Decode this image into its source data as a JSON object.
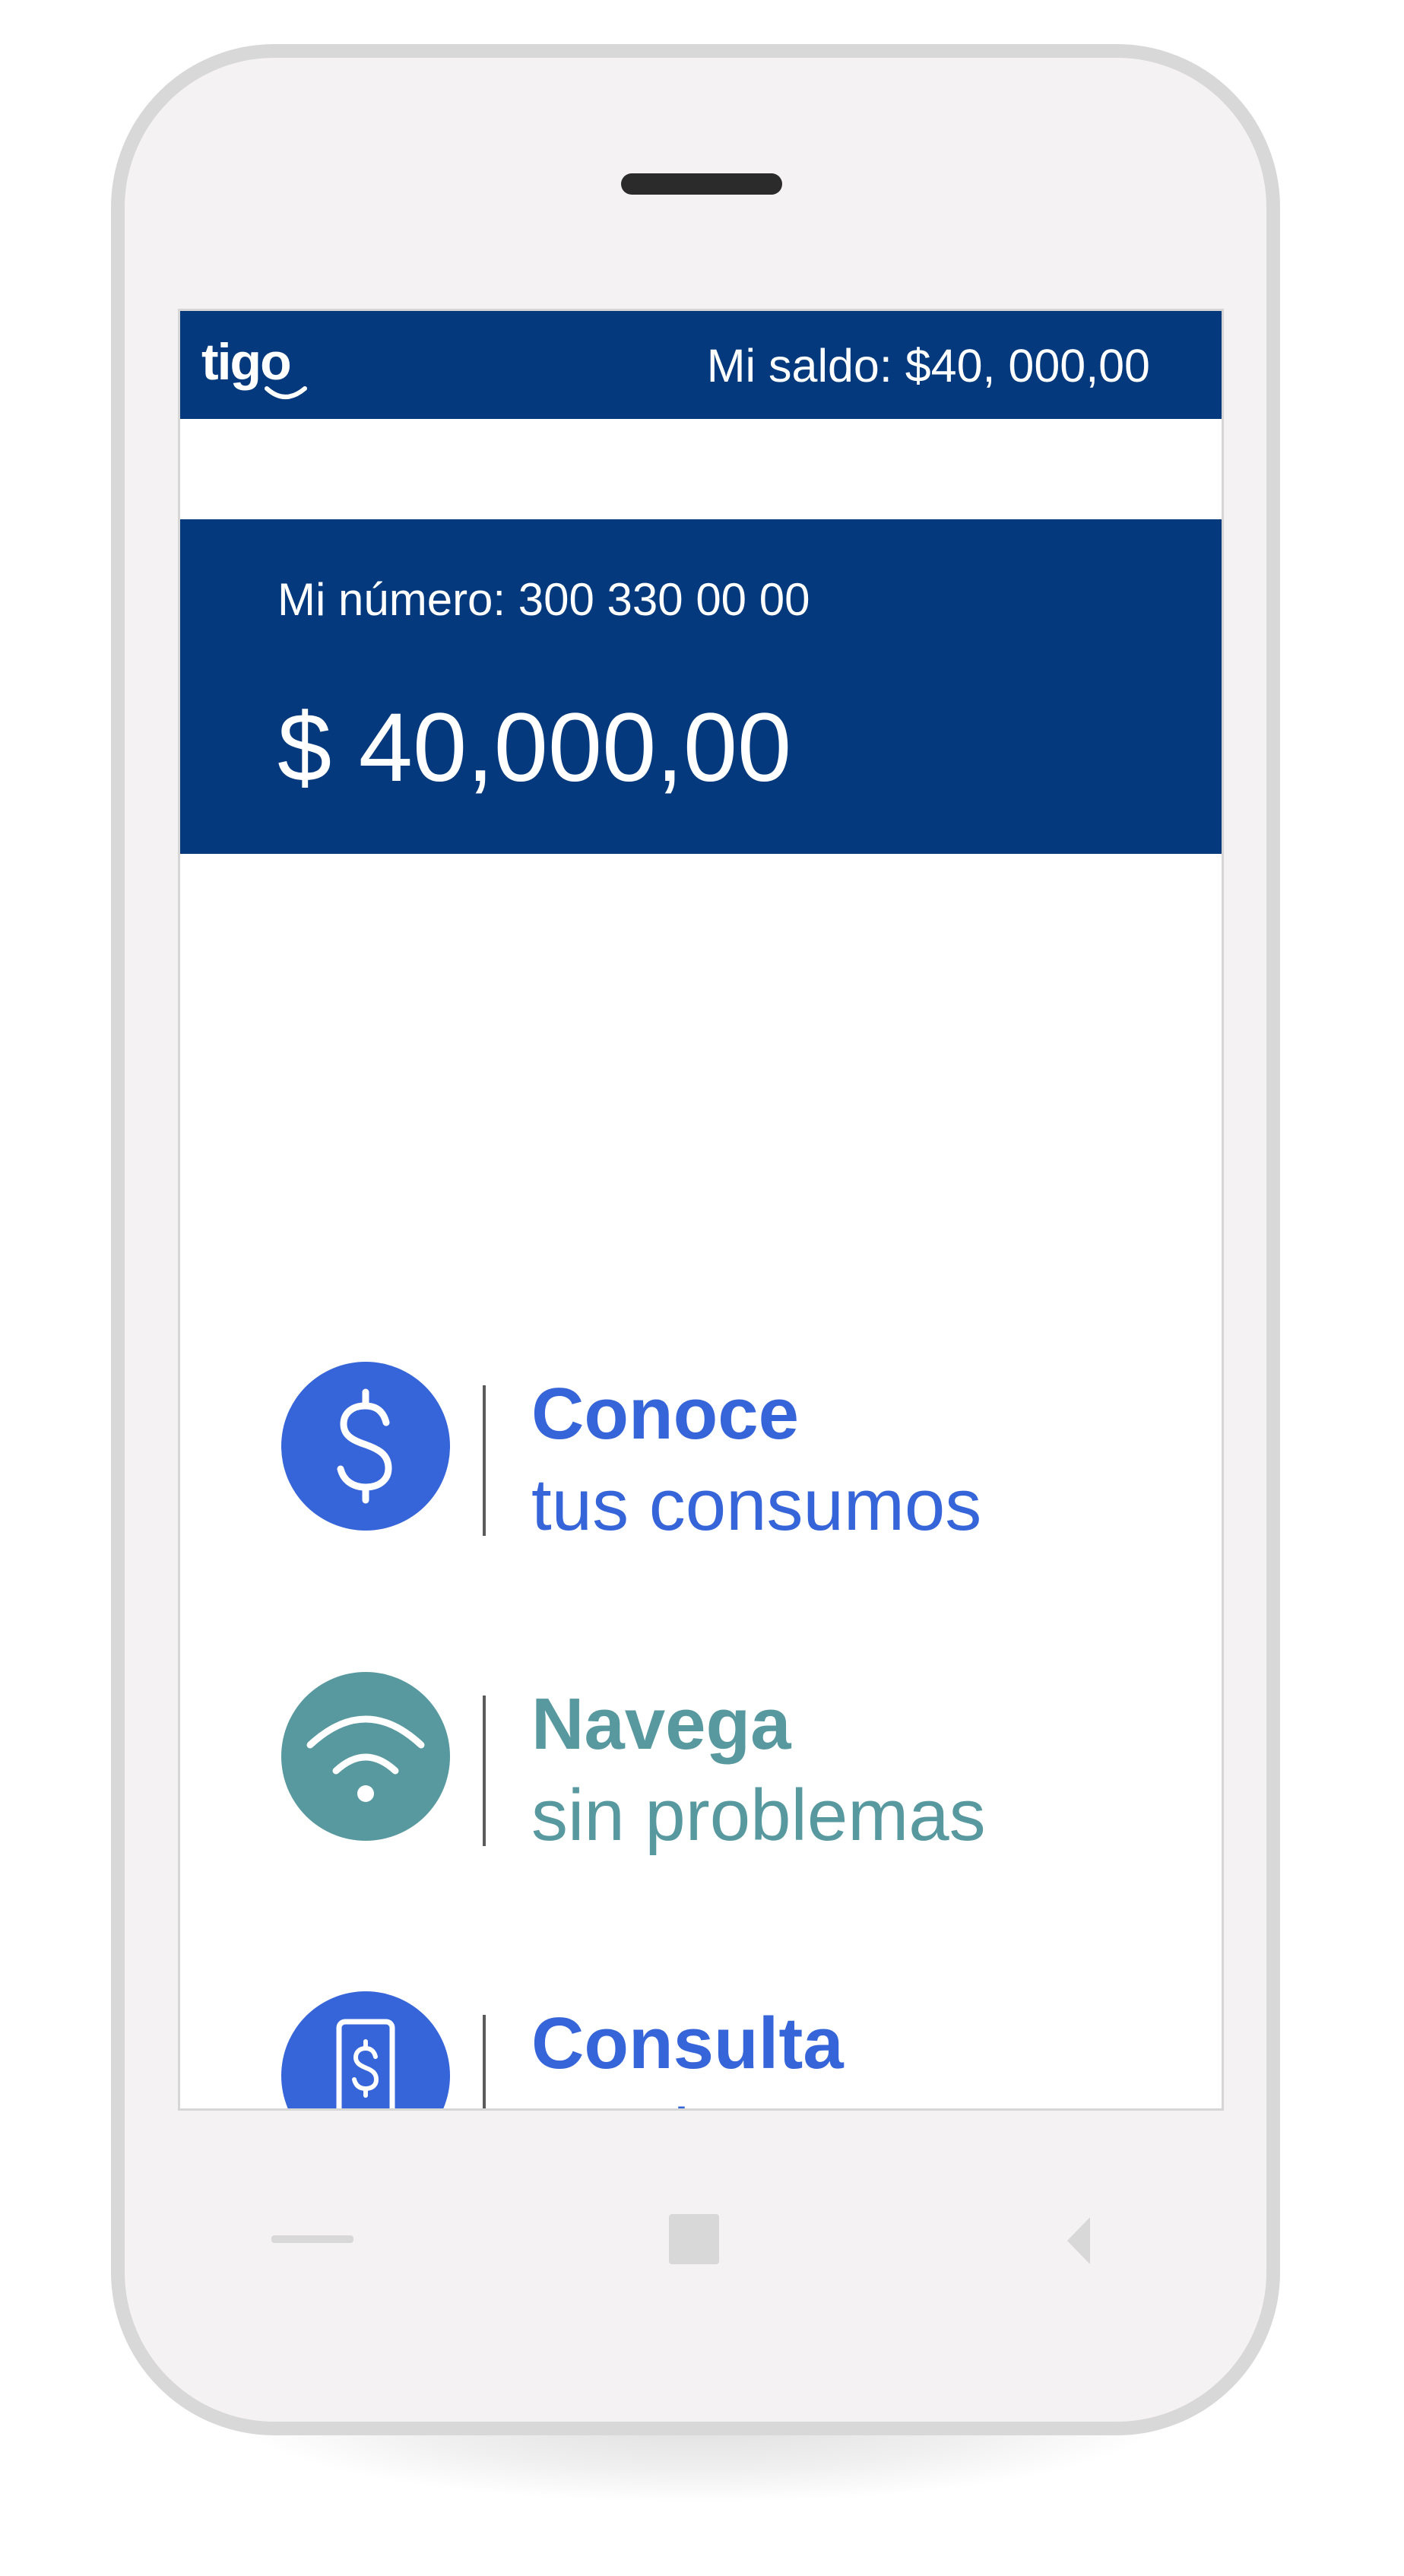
{
  "header": {
    "logo_text": "tigo",
    "saldo_text": "Mi saldo: $40, 000,00"
  },
  "balance": {
    "numero_text": "Mi número: 300 330 00 00",
    "amount": "$ 40,000,00"
  },
  "items": [
    {
      "title": "Conoce",
      "subtitle": "tus consumos",
      "icon": "dollar-icon",
      "color": "#3664d9"
    },
    {
      "title": "Navega",
      "subtitle": "sin problemas",
      "icon": "wifi-icon",
      "color": "#58999f"
    },
    {
      "title": "Consulta",
      "subtitle": "tus datos",
      "icon": "phone-dollar-icon",
      "color": "#3664d9"
    }
  ],
  "navbar": {
    "buttons": [
      "recents-icon",
      "home-icon",
      "back-icon"
    ]
  },
  "colors": {
    "brand_navy": "#043a7d",
    "accent_blue": "#3664d9",
    "accent_teal": "#58999f"
  }
}
